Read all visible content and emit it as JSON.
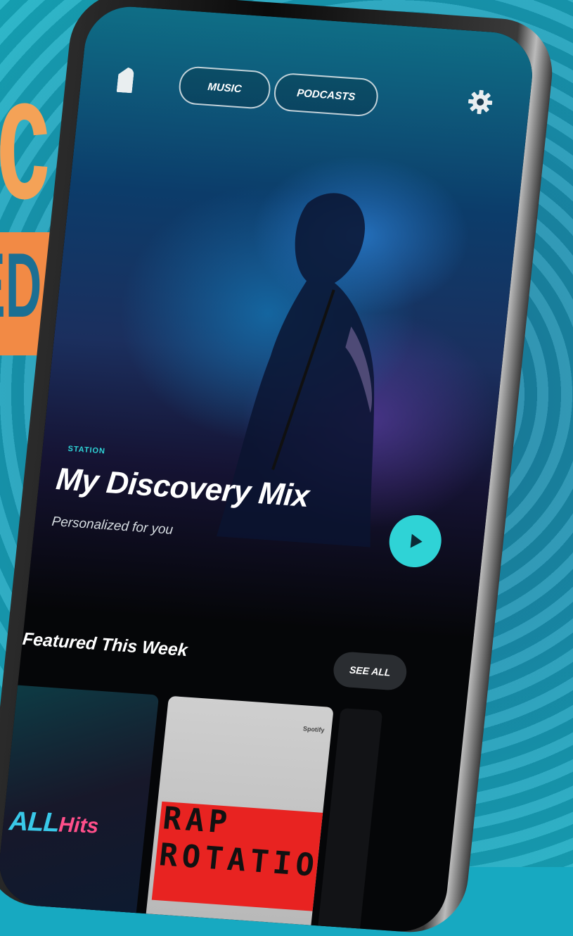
{
  "promo": {
    "headline_fragment": "ic",
    "badge_fragment": "ED"
  },
  "top_bar": {
    "tabs": [
      {
        "label": "MUSIC"
      },
      {
        "label": "PODCASTS"
      }
    ]
  },
  "hero": {
    "tag": "STATION",
    "title": "My Discovery Mix",
    "subtitle": "Personalized for you"
  },
  "featured": {
    "section_title": "Featured This Week",
    "see_all_label": "SEE ALL",
    "cards": [
      {
        "title_part1": "ALL",
        "title_part2": "Hits"
      },
      {
        "brand": "Spotify",
        "line1": "RAP",
        "line2": "ROTATION"
      }
    ]
  },
  "colors": {
    "accent": "#2fd3d6",
    "promo_orange": "#f28a45",
    "background": "#17a9c1"
  },
  "icons": [
    "app-logo-icon",
    "gear-icon",
    "play-icon"
  ]
}
